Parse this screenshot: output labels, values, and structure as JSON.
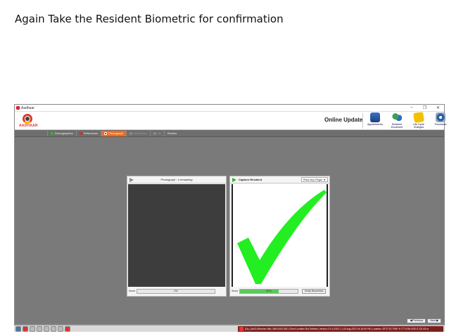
{
  "slide": {
    "title": "Again Take the Resident Biometric for confirmation"
  },
  "window": {
    "title": "Aadhaar",
    "minimize": "–",
    "maximize": "❐",
    "close": "✕"
  },
  "header": {
    "logo_text": "AADHAAR",
    "app_title": "Online Update",
    "nav": [
      {
        "label": "Appointments",
        "icon": "appointments-icon"
      },
      {
        "label": "Resident Enrolment",
        "icon": "resident-enrolment-icon"
      },
      {
        "label": "Life Cycle Changes",
        "icon": "life-cycle-icon"
      },
      {
        "label": "Processes",
        "icon": "processes-icon"
      }
    ]
  },
  "tabs": [
    {
      "label": "Demographics",
      "state": "done",
      "color": "#2fb52f"
    },
    {
      "label": "References",
      "state": "done",
      "color": "#c0392b"
    },
    {
      "label": "Photograph",
      "state": "active",
      "color": "#ffffff"
    },
    {
      "label": "Biometrics",
      "state": "disabled",
      "color": "#999999"
    },
    {
      "label": "Iris",
      "state": "disabled",
      "color": "#999999"
    },
    {
      "label": "Review",
      "state": "normal",
      "color": "#cccccc"
    }
  ],
  "photo_panel": {
    "title": "Photograph : 4 remaining",
    "score_label": "Score",
    "score_value": "0%",
    "score_fraction": 0
  },
  "capture_panel": {
    "title": "Capture Resident",
    "finger_select": "Place Any Finger",
    "score_label": "Score",
    "score_value": "67%",
    "score_fraction": 0.67,
    "verify_label": "Verify Biometrics",
    "check_color": "#22ee22"
  },
  "footer": {
    "previous": "◀ Previous",
    "next": "Next ▶"
  },
  "status_bar": {
    "text": "(Op_Qa01) Bhushan Sati | 068-0004-3001-Client Location Not Defined | version 2.5.4.2/102-1 | 16-Aug-2022 04:16:44 PM | Location: 28°37'23.7905\" N 77°14'36.4700 E 221.53 m"
  }
}
